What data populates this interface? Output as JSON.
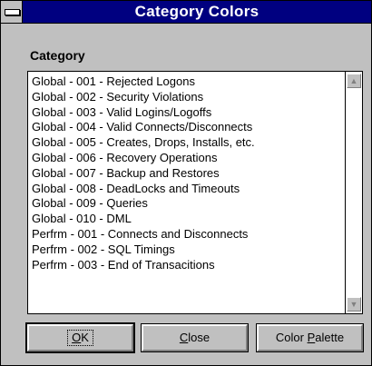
{
  "window": {
    "title": "Category Colors"
  },
  "category_label": "Category",
  "categories": [
    "Global - 001 - Rejected Logons",
    "Global - 002 - Security Violations",
    "Global - 003 - Valid Logins/Logoffs",
    "Global - 004 - Valid Connects/Disconnects",
    "Global - 005 - Creates, Drops, Installs, etc.",
    "Global - 006 - Recovery Operations",
    "Global - 007 - Backup and Restores",
    "Global - 008 - DeadLocks and Timeouts",
    "Global - 009 - Queries",
    "Global - 010 - DML",
    "Perfrm - 001 - Connects and Disconnects",
    "Perfrm - 002 - SQL Timings",
    "Perfrm - 003 - End of Transacitions"
  ],
  "scroll_icons": {
    "up": "arrow-up-icon",
    "down": "arrow-down-icon"
  },
  "buttons": {
    "ok": {
      "accel": "O",
      "rest": "K"
    },
    "close": {
      "accel": "C",
      "rest": "lose"
    },
    "palette": {
      "pre": "Color ",
      "accel": "P",
      "rest": "alette"
    }
  },
  "colors": {
    "titlebar": "#000080",
    "face": "#c0c0c0"
  }
}
